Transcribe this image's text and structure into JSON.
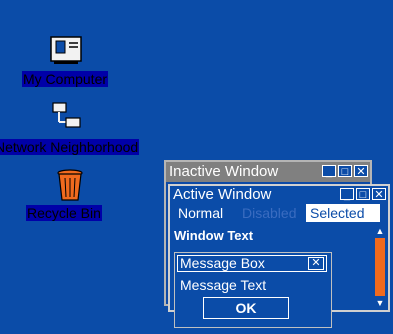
{
  "desktop": {
    "icons": [
      {
        "label": "My Computer",
        "icon": "computer-icon"
      },
      {
        "label": "Network Neighborhood",
        "icon": "network-icon"
      },
      {
        "label": "Recycle Bin",
        "icon": "recycle-bin-icon"
      }
    ]
  },
  "inactive_window": {
    "title": "Inactive Window"
  },
  "active_window": {
    "title": "Active Window",
    "menu": {
      "normal": "Normal",
      "disabled": "Disabled",
      "selected": "Selected"
    },
    "window_text": "Window Text"
  },
  "message_box": {
    "title": "Message Box",
    "text": "Message Text",
    "ok_label": "OK"
  },
  "colors": {
    "desktop": "#0b4ca8",
    "selection": "#0000a8",
    "scroll_thumb": "#f06a1e",
    "inactive_title": "#808080"
  }
}
